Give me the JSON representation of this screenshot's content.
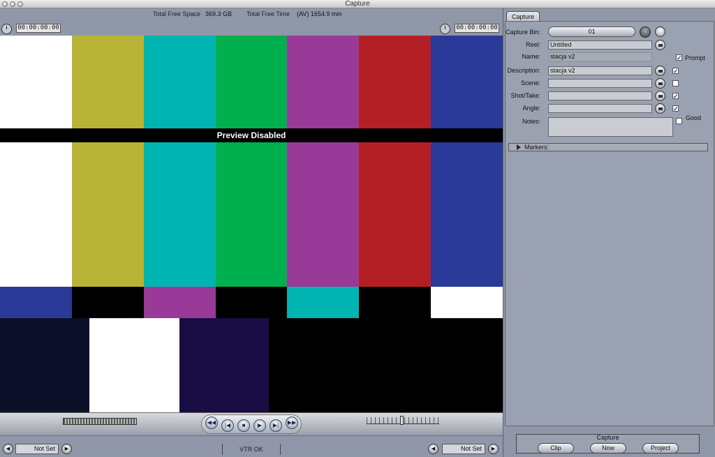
{
  "window": {
    "title": "Capture"
  },
  "info": {
    "free_space_label": "Total Free Space",
    "free_space_value": "369.3 GB",
    "free_time_label": "Total Free Time",
    "free_time_value": "(AV) 1654.9 min"
  },
  "timecode": {
    "duration": "00:00:00:00",
    "current": "00:00:00:00"
  },
  "preview": {
    "status_text": "Preview Disabled"
  },
  "colorbars": {
    "top": [
      "#ffffff",
      "#b8b436",
      "#00b4b2",
      "#00b04e",
      "#9a3a98",
      "#b41f26",
      "#2a3a98"
    ],
    "middle": [
      "#2a3a98",
      "#000000",
      "#9a3a98",
      "#000000",
      "#00b4b2",
      "#000000",
      "#ffffff"
    ],
    "bottom": [
      "#0b1028",
      "#ffffff",
      "#1a0d44",
      "#000000"
    ]
  },
  "transport": {
    "buttons": [
      {
        "name": "rewind-icon",
        "glyph": "◀◀"
      },
      {
        "name": "prev-edit-icon",
        "glyph": "|◀"
      },
      {
        "name": "stop-icon",
        "glyph": "■"
      },
      {
        "name": "play-icon",
        "glyph": "▶"
      },
      {
        "name": "next-edit-icon",
        "glyph": "▶|"
      },
      {
        "name": "fast-forward-icon",
        "glyph": "▶▶"
      }
    ]
  },
  "bottom": {
    "in_point": "Not Set",
    "out_point": "Not Set",
    "vtr_status": "VTR OK"
  },
  "panel": {
    "tab_label": "Capture",
    "capture_bin_label": "Capture Bin:",
    "capture_bin_value": "01",
    "reel_label": "Reel:",
    "reel_value": "Untitled",
    "name_label": "Name:",
    "name_value": "stacja v2",
    "prompt_label": "Prompt",
    "description_label": "Description:",
    "description_value": "stacja v2",
    "scene_label": "Scene:",
    "scene_value": "",
    "shot_label": "Shot/Take:",
    "shot_value": "",
    "angle_label": "Angle:",
    "angle_value": "",
    "notes_label": "Notes:",
    "good_label": "Good",
    "markers_label": "Markers:"
  },
  "capture": {
    "title": "Capture",
    "clip_label": "Clip",
    "now_label": "Now",
    "project_label": "Project"
  }
}
